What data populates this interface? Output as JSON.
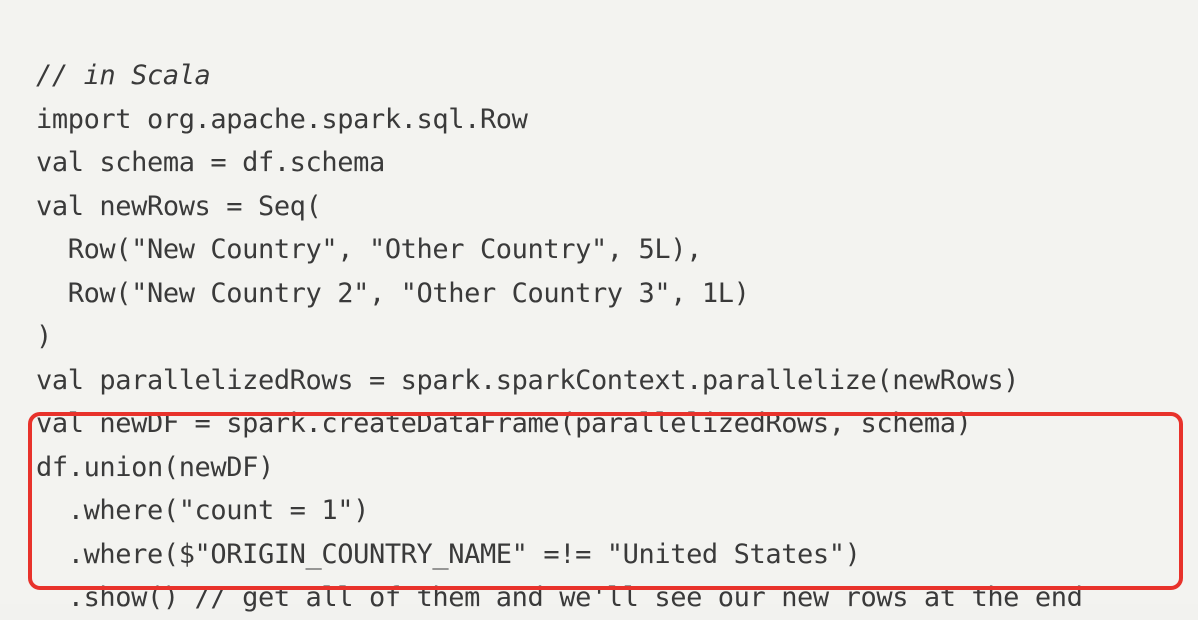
{
  "code": {
    "lines": [
      "// in Scala",
      "import org.apache.spark.sql.Row",
      "val schema = df.schema",
      "val newRows = Seq(",
      "  Row(\"New Country\", \"Other Country\", 5L),",
      "  Row(\"New Country 2\", \"Other Country 3\", 1L)",
      ")",
      "val parallelizedRows = spark.sparkContext.parallelize(newRows)",
      "val newDF = spark.createDataFrame(parallelizedRows, schema)",
      "df.union(newDF)",
      "  .where(\"count = 1\")",
      "  .where($\"ORIGIN_COUNTRY_NAME\" =!= \"United States\")",
      "  .show() // get all of them and we'll see our new rows at the end"
    ]
  },
  "highlight": {
    "color": "#e8322b"
  }
}
